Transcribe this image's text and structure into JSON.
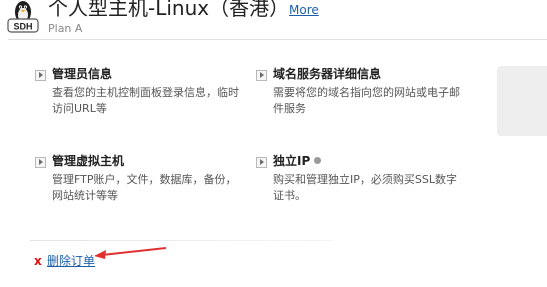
{
  "header": {
    "logo_text": "SDH",
    "title": "个人型主机-Linux（香港）",
    "more_link": "More",
    "plan": "Plan A"
  },
  "items": [
    {
      "heading": "管理员信息",
      "description": "查看您的主机控制面板登录信息，临时访问URL等"
    },
    {
      "heading": "域名服务器详细信息",
      "description": "需要将您的域名指向您的网站或电子邮件服务"
    },
    {
      "heading": "管理虚拟主机",
      "description": "管理FTP账户，文件，数据库，备份，网站统计等等"
    },
    {
      "heading": "独立IP",
      "description": "购买和管理独立IP，必须购买SSL数字证书。"
    }
  ],
  "footer": {
    "delete_icon": "x",
    "delete_link": "删除订单"
  },
  "colors": {
    "link": "#1c5fa8",
    "delete_x": "#dd1111",
    "annotation_arrow": "#e03030"
  },
  "icons": {
    "logo": "tux-penguin-icon",
    "arrow": "arrow-right-icon",
    "status": "status-dot-icon",
    "annotation": "red-annotation-arrow"
  }
}
